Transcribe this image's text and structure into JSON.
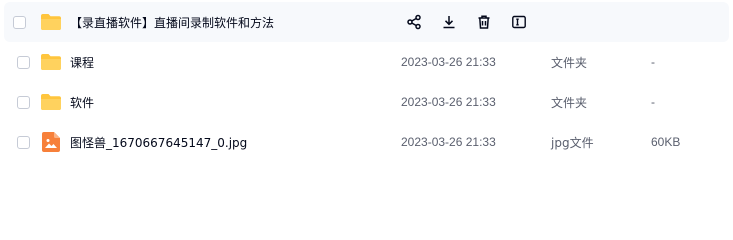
{
  "rows": [
    {
      "name": "【录直播软件】直播间录制软件和方法",
      "icon": "folder-icon",
      "hover": true,
      "actions": [
        "share-icon",
        "download-icon",
        "delete-icon",
        "rename-icon"
      ]
    },
    {
      "name": "课程",
      "date": "2023-03-26 21:33",
      "type": "文件夹",
      "size": "-",
      "icon": "folder-icon"
    },
    {
      "name": "软件",
      "date": "2023-03-26 21:33",
      "type": "文件夹",
      "size": "-",
      "icon": "folder-icon"
    },
    {
      "name": "图怪兽_1670667645147_0.jpg",
      "date": "2023-03-26 21:33",
      "type": "jpg文件",
      "size": "60KB",
      "icon": "image-file-icon"
    }
  ],
  "colors": {
    "folder": "#ffc53d",
    "image": "#f7803a",
    "hover_bg": "#f7f9fc"
  }
}
